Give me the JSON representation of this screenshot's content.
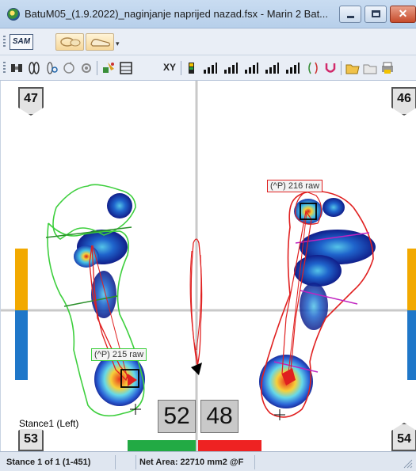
{
  "window": {
    "title": "BatuM05_(1.9.2022)_naginjanje naprijed nazad.fsx - Marin 2 Bat...",
    "close_glyph": "✕",
    "minimize_icon": "minimize-icon",
    "maximize_icon": "maximize-icon"
  },
  "toolbar1": {
    "sam_label": "SAM",
    "buttons": [
      "footprint-magnify-icon",
      "shoe-icon"
    ]
  },
  "toolbar2": {
    "xy_label": "XY",
    "tools": [
      "binoculars-icon",
      "foot-pair-icon",
      "foot-search-icon",
      "gear-icon",
      "color-tool-icon",
      "grid-icon",
      "xy-icon",
      "bars-icon",
      "chart-icon",
      "folder-open-icon",
      "print-icon"
    ]
  },
  "plot": {
    "tag_top_left": "47",
    "tag_top_right": "46",
    "tag_bottom_left": "53",
    "tag_bottom_right": "54",
    "left_count": "52",
    "right_count": "48",
    "left_peak_label": "(^P) 215 raw",
    "right_peak_label": "(^P) 216 raw",
    "stance_label": "Stance1 (Left)",
    "colors": {
      "left_outline": "#3ecf3e",
      "right_outline": "#e02020",
      "left_balance": "#22aa44",
      "right_balance": "#ee2222",
      "side_top": "#f2a900",
      "side_bottom": "#1f77c9"
    }
  },
  "statusbar": {
    "stance": "Stance 1 of 1 (1-451)",
    "net_area": "Net Area: 22710 mm2 @F"
  }
}
